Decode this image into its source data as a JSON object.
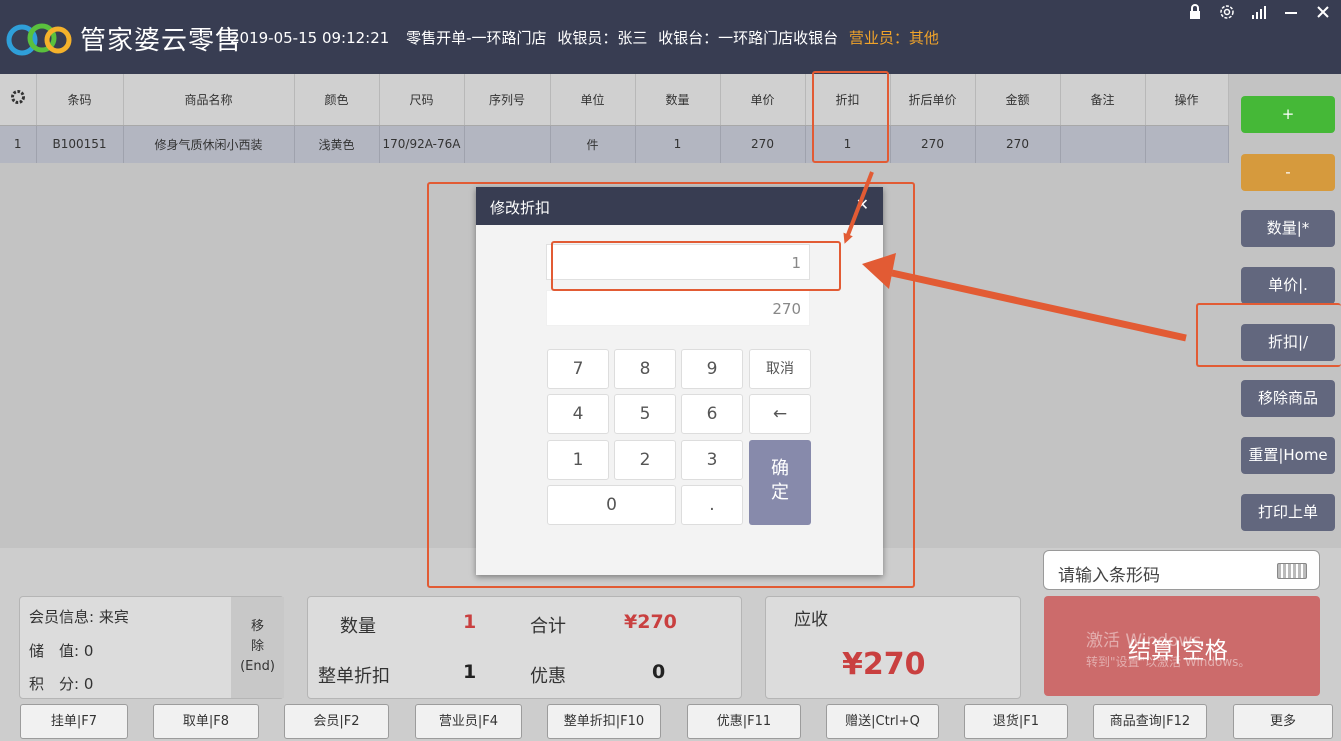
{
  "header": {
    "app_name": "管家婆云零售",
    "datetime": "2019-05-15 09:12:21",
    "order_type": "零售开单",
    "store": "-一环路门店",
    "cashier": "收银员：张三",
    "register": "收银台：一环路门店收银台",
    "sales_person": "营业员：其他",
    "icons": [
      "lock-icon",
      "settings-icon",
      "signal-icon",
      "minimize-icon",
      "close-icon"
    ],
    "colors": {
      "bar": "#383d52",
      "sales_person": "#f0a32a"
    }
  },
  "table": {
    "columns": [
      "条码",
      "商品名称",
      "颜色",
      "尺码",
      "序列号",
      "单位",
      "数量",
      "单价",
      "折扣",
      "折后单价",
      "金额",
      "备注",
      "操作"
    ],
    "rows": [
      {
        "index": "1",
        "barcode": "B100151",
        "name": "修身气质休闲小西装",
        "color": "浅黄色",
        "size": "170/92A-76A",
        "serial": "",
        "unit": "件",
        "qty": "1",
        "price": "270",
        "discount": "1",
        "discounted_price": "270",
        "amount": "270",
        "note": "",
        "action": ""
      }
    ]
  },
  "side_buttons": {
    "plus": "+",
    "minus": "-",
    "quantity": "数量|*",
    "unit_price": "单价|.",
    "discount": "折扣|/",
    "remove_item": "移除商品",
    "reset": "重置|Home",
    "print_last": "打印上单",
    "colors": {
      "plus": "#45b837",
      "minus": "#d69a3d",
      "default": "#62677e"
    }
  },
  "modal": {
    "title": "修改折扣",
    "discount_value": "1",
    "price_value": "270",
    "keys": [
      "7",
      "8",
      "9",
      "取消",
      "4",
      "5",
      "6",
      "←",
      "1",
      "2",
      "3",
      "0",
      "."
    ],
    "confirm": "确\n定"
  },
  "bottom": {
    "barcode_placeholder": "请输入条形码",
    "member_info": "会员信息: 来宾",
    "stored_value": "储　值: 0",
    "points": "积　分: 0",
    "remove_member": "移\n除\n(End)",
    "stats": {
      "qty_label": "数量",
      "qty_value": "1",
      "total_label": "合计",
      "total_value": "¥270",
      "order_discount_label": "整单折扣",
      "order_discount_value": "1",
      "promo_label": "优惠",
      "promo_value": "0"
    },
    "due_label": "应收",
    "due_amount": "¥270",
    "checkout": "结算|空格",
    "activate_windows": "激活 Windows",
    "activate_windows_sub": "转到\"设置\"以激活 Windows。",
    "fkeys": [
      "挂单|F7",
      "取单|F8",
      "会员|F2",
      "营业员|F4",
      "整单折扣|F10",
      "优惠|F11",
      "赠送|Ctrl+Q",
      "退货|F1",
      "商品查询|F12",
      "更多"
    ],
    "colors": {
      "checkout": "#cc6b6b",
      "amount": "#c94040"
    }
  },
  "annotation": {
    "color": "#e25b34"
  }
}
